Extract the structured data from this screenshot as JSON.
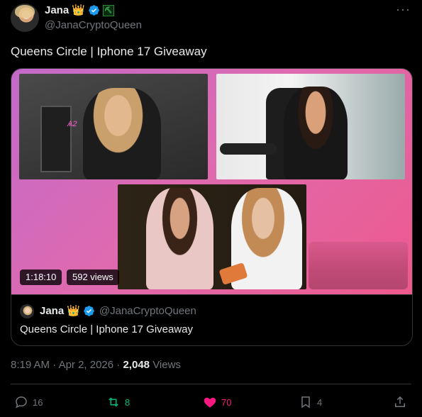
{
  "author": {
    "name": "Jana",
    "handle": "@JanaCryptoQueen",
    "crown_emoji": "👑",
    "badge_glyph": "⛏"
  },
  "tweet": {
    "text": "Queens Circle | Iphone 17 Giveaway"
  },
  "video": {
    "duration": "1:18:10",
    "views": "592 views",
    "overlay_caption": "Ѧ2"
  },
  "quoted": {
    "name": "Jana",
    "handle": "@JanaCryptoQueen",
    "text": "Queens Circle | Iphone 17 Giveaway"
  },
  "meta": {
    "time": "8:19 AM",
    "separator": "·",
    "date": "Apr 2, 2026",
    "views_count": "2,048",
    "views_label": "Views"
  },
  "actions": {
    "replies": "16",
    "reposts": "8",
    "likes": "70",
    "bookmarks": "4"
  },
  "colors": {
    "background": "#000000",
    "text": "#e7e9ea",
    "muted": "#71767b",
    "verified": "#1d9bf0",
    "repost_active": "#00ba7c",
    "like_active": "#f91880",
    "border": "#2f3336"
  }
}
